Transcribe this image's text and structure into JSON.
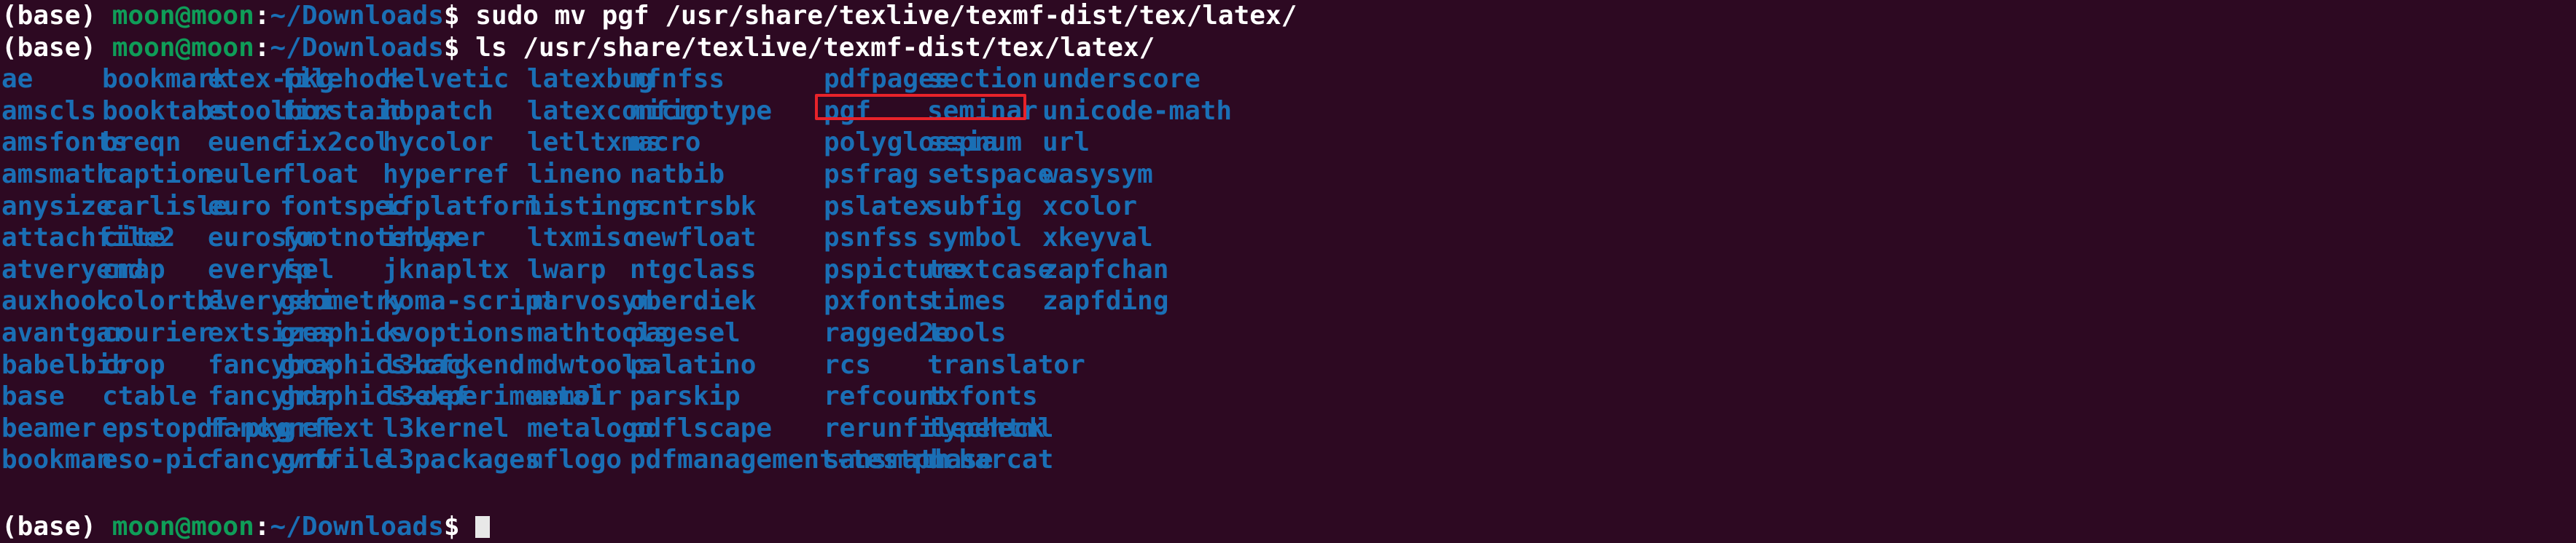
{
  "terminal": {
    "background_color": "#2d0922",
    "foreground_color": "#ffffff",
    "package_color": "#1a6fb5",
    "user_host_color": "#0f9d58",
    "path_color": "#1a6fb5",
    "highlight_color": "#e8232a",
    "prompt": {
      "env": "(base) ",
      "user_host": "moon@moon",
      "colon": ":",
      "path": "~/Downloads",
      "sigil": "$ "
    },
    "commands": [
      "sudo mv pgf /usr/share/texlive/texmf-dist/tex/latex/",
      "ls /usr/share/texlive/texmf-dist/tex/latex/"
    ],
    "final_prompt_command": "",
    "highlighted_package": "pgf"
  },
  "listing": {
    "columns": [
      [
        "ae",
        "amscls",
        "amsfonts",
        "amsmath",
        "anysize",
        "attachfile2",
        "atveryend",
        "auxhook",
        "avantgar",
        "babelbib",
        "base",
        "beamer",
        "bookman"
      ],
      [
        "bookmark",
        "booktabs",
        "breqn",
        "caption",
        "carlisle",
        "cite",
        "cmap",
        "colortbl",
        "courier",
        "crop",
        "ctable",
        "epstopdf-pkg",
        "eso-pic"
      ],
      [
        "etex-pkg",
        "etoolbox",
        "euenc",
        "euler",
        "euro",
        "eurosym",
        "everysel",
        "everyshi",
        "extsizes",
        "fancybox",
        "fancyhdr",
        "fancyref",
        "fancyvrb"
      ],
      [
        "filehook",
        "firstaid",
        "fix2col",
        "float",
        "fontspec",
        "footnotehyper",
        "fp",
        "geometry",
        "graphics",
        "graphics-cfg",
        "graphics-def",
        "grfext",
        "grffile"
      ],
      [
        "helvetic",
        "hopatch",
        "hycolor",
        "hyperref",
        "ifplatform",
        "index",
        "jknapltx",
        "koma-script",
        "kvoptions",
        "l3backend",
        "l3experimental",
        "l3kernel",
        "l3packages"
      ],
      [
        "latexbug",
        "latexconfig",
        "letltxmacro",
        "lineno",
        "listings",
        "ltxmisc",
        "lwarp",
        "marvosym",
        "mathtools",
        "mdwtools",
        "memoir",
        "metalogo",
        "mflogo"
      ],
      [
        "mfnfss",
        "microtype",
        "ms",
        "natbib",
        "ncntrsbk",
        "newfloat",
        "ntgclass",
        "oberdiek",
        "pagesel",
        "palatino",
        "parskip",
        "pdflscape",
        "pdfmanagement-testphase"
      ],
      [
        "pdfpages",
        "pgf",
        "polyglossia",
        "psfrag",
        "pslatex",
        "psnfss",
        "pspicture",
        "pxfonts",
        "ragged2e",
        "rcs",
        "refcount",
        "rerunfilecheck",
        "sansmath"
      ],
      [
        "section",
        "seminar",
        "sepnum",
        "setspace",
        "subfig",
        "symbol",
        "textcase",
        "times",
        "tools",
        "translator",
        "txfonts",
        "typehtml",
        "ucharcat"
      ],
      [
        "underscore",
        "unicode-math",
        "url",
        "wasysym",
        "xcolor",
        "xkeyval",
        "zapfchan",
        "zapfding"
      ]
    ],
    "column_x": [
      2,
      140,
      285,
      384,
      525,
      723,
      864,
      1130,
      1272,
      1430
    ]
  }
}
